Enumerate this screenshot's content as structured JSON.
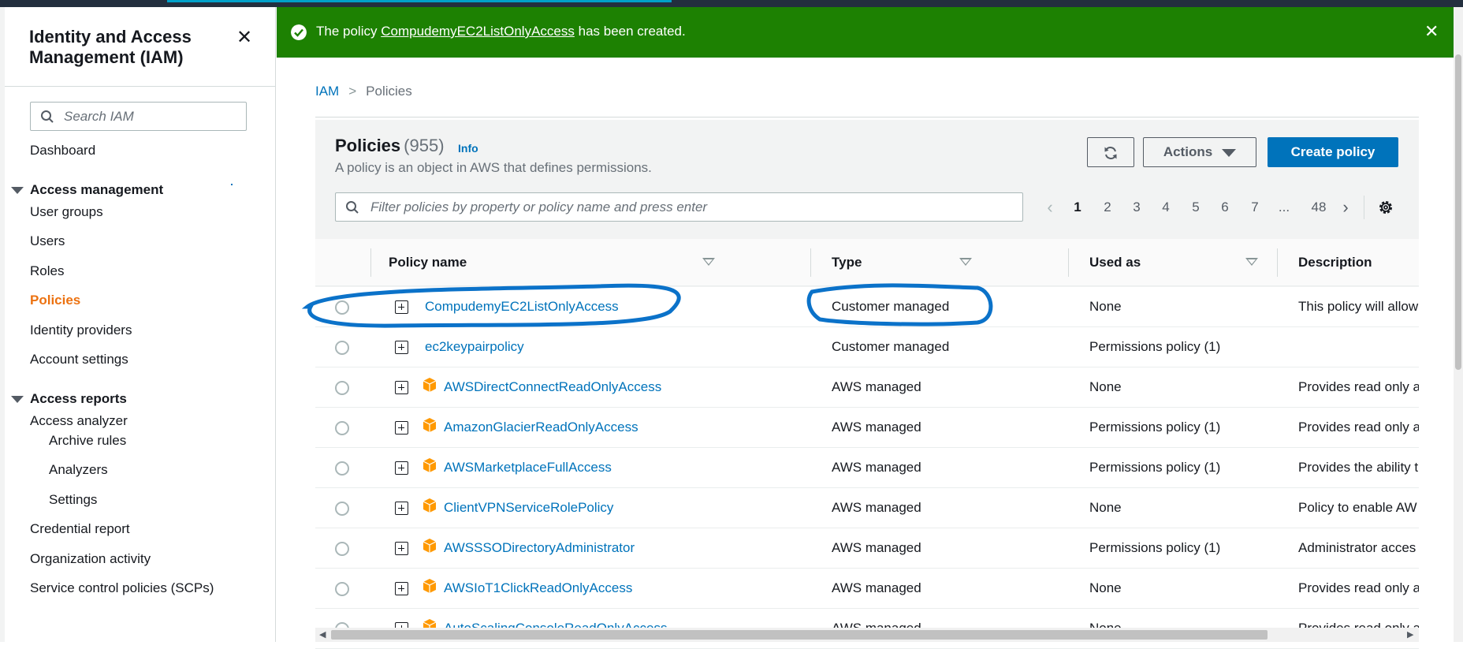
{
  "sidebar": {
    "title": "Identity and Access Management (IAM)",
    "search_placeholder": "Search IAM",
    "dashboard": "Dashboard",
    "access_management": {
      "heading": "Access management",
      "items": [
        "User groups",
        "Users",
        "Roles",
        "Policies",
        "Identity providers",
        "Account settings"
      ],
      "active": "Policies"
    },
    "access_reports": {
      "heading": "Access reports",
      "items": [
        "Access analyzer",
        "Archive rules",
        "Analyzers",
        "Settings",
        "Credential report",
        "Organization activity",
        "Service control policies (SCPs)"
      ]
    }
  },
  "flash": {
    "prefix": "The policy",
    "policy_link": "CompudemyEC2ListOnlyAccess",
    "suffix": "has been created.",
    "color": "#1d8102"
  },
  "breadcrumb": {
    "root": "IAM",
    "current": "Policies"
  },
  "panel": {
    "title": "Policies",
    "count": "(955)",
    "info": "Info",
    "description": "A policy is an object in AWS that defines permissions.",
    "actions_label": "Actions",
    "create_label": "Create policy",
    "filter_placeholder": "Filter policies by property or policy name and press enter",
    "pagination": {
      "pages": [
        "1",
        "2",
        "3",
        "4",
        "5",
        "6",
        "7",
        "...",
        "48"
      ],
      "current": "1"
    }
  },
  "table": {
    "columns": [
      "Policy name",
      "Type",
      "Used as",
      "Description"
    ],
    "rows": [
      {
        "name": "CompudemyEC2ListOnlyAccess",
        "type": "Customer managed",
        "used_as": "None",
        "description": "This policy will allow",
        "aws_icon": false
      },
      {
        "name": "ec2keypairpolicy",
        "type": "Customer managed",
        "used_as": "Permissions policy (1)",
        "description": "",
        "aws_icon": false
      },
      {
        "name": "AWSDirectConnectReadOnlyAccess",
        "type": "AWS managed",
        "used_as": "None",
        "description": "Provides read only a",
        "aws_icon": true
      },
      {
        "name": "AmazonGlacierReadOnlyAccess",
        "type": "AWS managed",
        "used_as": "Permissions policy (1)",
        "description": "Provides read only a",
        "aws_icon": true
      },
      {
        "name": "AWSMarketplaceFullAccess",
        "type": "AWS managed",
        "used_as": "Permissions policy (1)",
        "description": "Provides the ability t",
        "aws_icon": true
      },
      {
        "name": "ClientVPNServiceRolePolicy",
        "type": "AWS managed",
        "used_as": "None",
        "description": "Policy to enable AW",
        "aws_icon": true
      },
      {
        "name": "AWSSSODirectoryAdministrator",
        "type": "AWS managed",
        "used_as": "Permissions policy (1)",
        "description": "Administrator acces",
        "aws_icon": true
      },
      {
        "name": "AWSIoT1ClickReadOnlyAccess",
        "type": "AWS managed",
        "used_as": "None",
        "description": "Provides read only a",
        "aws_icon": true
      },
      {
        "name": "AutoScalingConsoleReadOnlyAccess",
        "type": "AWS managed",
        "used_as": "None",
        "description": "Provides read only a",
        "aws_icon": true
      }
    ]
  },
  "colors": {
    "link": "#0073bb",
    "active_nav": "#ec7211",
    "primary_button": "#0073bb",
    "aws_icon": "#ff9900",
    "annotation": "#0b72c9"
  }
}
